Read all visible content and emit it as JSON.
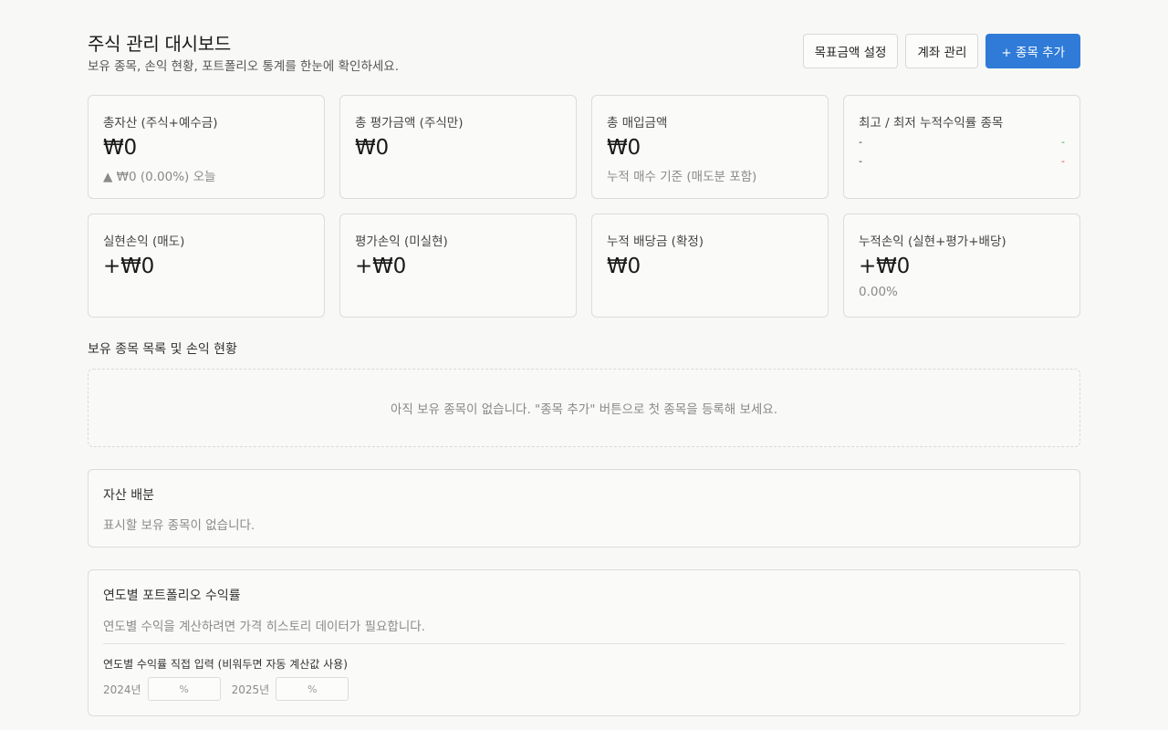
{
  "header": {
    "title": "주식 관리 대시보드",
    "subtitle": "보유 종목, 손익 현황, 포트폴리오 통계를 한눈에 확인하세요.",
    "buttons": {
      "target": "목표금액 설정",
      "accounts": "계좌 관리",
      "add": "+ 종목 추가"
    }
  },
  "stats": {
    "total_assets": {
      "label": "총자산 (주식+예수금)",
      "value": "₩0",
      "sub": "▲ ₩0 (0.00%) 오늘"
    },
    "total_eval": {
      "label": "총 평가금액 (주식만)",
      "value": "₩0"
    },
    "total_purchase": {
      "label": "총 매입금액",
      "value": "₩0",
      "sub": "누적 매수 기준 (매도분 포함)"
    },
    "best_worst": {
      "label": "최고 / 최저 누적수익률 종목",
      "best_name": "-",
      "best_value": "-",
      "worst_name": "-",
      "worst_value": "-"
    },
    "realized": {
      "label": "실현손익 (매도)",
      "value": "+₩0"
    },
    "unrealized": {
      "label": "평가손익 (미실현)",
      "value": "+₩0"
    },
    "dividends": {
      "label": "누적 배당금 (확정)",
      "value": "₩0"
    },
    "cumulative": {
      "label": "누적손익 (실현+평가+배당)",
      "value": "+₩0",
      "sub": "0.00%"
    }
  },
  "holdings": {
    "title": "보유 종목 목록 및 손익 현황",
    "empty": "아직 보유 종목이 없습니다. \"종목 추가\" 버튼으로 첫 종목을 등록해 보세요."
  },
  "allocation": {
    "title": "자산 배분",
    "empty": "표시할 보유 종목이 없습니다."
  },
  "yearly": {
    "title": "연도별 포트폴리오 수익률",
    "note": "연도별 수익을 계산하려면 가격 히스토리 데이터가 필요합니다.",
    "manual_label": "연도별 수익률 직접 입력 (비워두면 자동 계산값 사용)",
    "years": [
      {
        "label": "2024년",
        "placeholder": "%",
        "value": ""
      },
      {
        "label": "2025년",
        "placeholder": "%",
        "value": ""
      }
    ]
  },
  "colors": {
    "primary": "#2f7bd7",
    "positive": "#2aa84a",
    "negative": "#e0393e",
    "background": "#f8f8f6"
  }
}
